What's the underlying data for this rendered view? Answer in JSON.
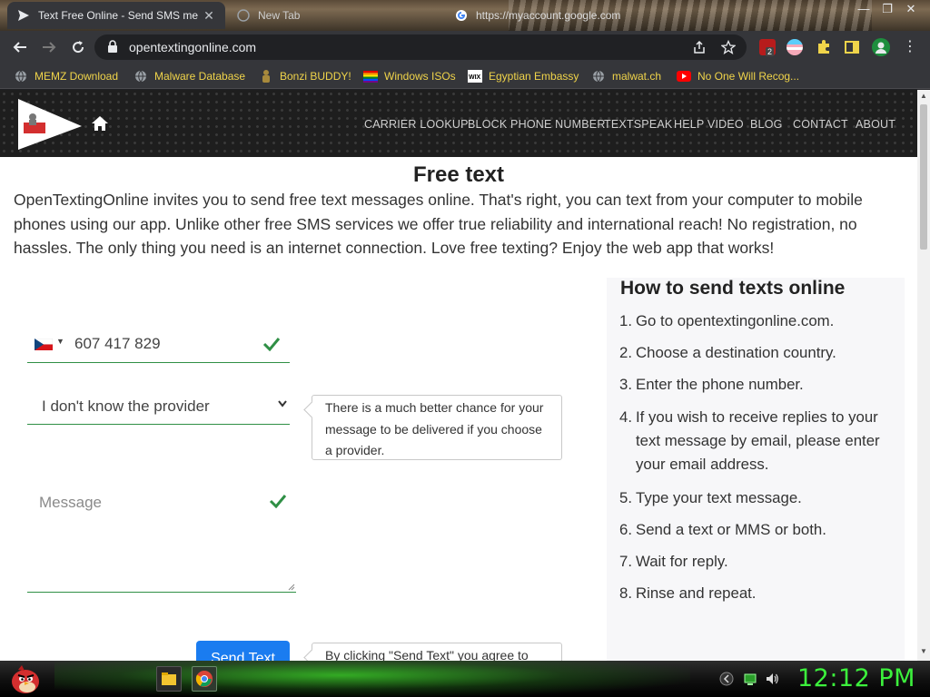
{
  "browser": {
    "tabs": [
      {
        "title": "Text Free Online - Send SMS me",
        "favicon": "send-arrow-icon",
        "active": true
      },
      {
        "title": "New Tab",
        "favicon": "globe-icon",
        "active": false
      },
      {
        "title": "https://myaccount.google.com",
        "favicon": "google-icon",
        "active": false
      }
    ],
    "url": "opentextingonline.com",
    "bookmarks": [
      {
        "label": "MEMZ Download",
        "icon": "globe-icon"
      },
      {
        "label": "Malware Database",
        "icon": "globe-icon"
      },
      {
        "label": "Bonzi BUDDY!",
        "icon": "bonzi-icon"
      },
      {
        "label": "Windows ISOs",
        "icon": "rainbow-flag-icon"
      },
      {
        "label": "Egyptian Embassy",
        "icon": "wix-icon"
      },
      {
        "label": "malwat.ch",
        "icon": "globe-icon"
      },
      {
        "label": "No One Will Recog...",
        "icon": "youtube-icon"
      }
    ],
    "extension_badge": "2"
  },
  "site": {
    "nav": [
      "CARRIER LOOKUP",
      "BLOCK PHONE NUMBER",
      "TEXTSPEAK",
      "HELP VIDEO",
      "BLOG",
      "CONTACT",
      "ABOUT"
    ],
    "title": "Free text",
    "intro": "OpenTextingOnline invites you to send free text messages online. That's right, you can text from your computer to mobile phones using our app. Unlike other free SMS services we offer true reliability and international reach! No registration, no hassles. The only thing you need is an internet connection. Love free texting? Enjoy the web app that works!",
    "form": {
      "country_flag": "czech-flag-icon",
      "phone_value": "607 417 829",
      "provider_value": "I don't know the provider",
      "provider_tip": "There is a much better chance for your message to be delivered if you choose a provider.",
      "message_placeholder": "Message",
      "send_label": "Send Text",
      "send_tip": "By clicking \"Send Text\" you agree to",
      "accent_color": "#2f8f45",
      "button_color": "#1a7cf0"
    },
    "howto": {
      "title": "How to send texts online",
      "steps": [
        {
          "n": "1.",
          "text": "Go to opentextingonline.com."
        },
        {
          "n": "2.",
          "text": "Choose a destination country."
        },
        {
          "n": "3.",
          "text": "Enter the phone number."
        },
        {
          "n": "4.",
          "text": "If you wish to receive replies to your text message by email, please enter your email address."
        },
        {
          "n": "5.",
          "text": "Type your text message."
        },
        {
          "n": "6.",
          "text": "Send a text or MMS or both."
        },
        {
          "n": "7.",
          "text": "Wait for reply."
        },
        {
          "n": "8.",
          "text": "Rinse and repeat."
        }
      ]
    }
  },
  "taskbar": {
    "clock": "12:12 PM",
    "clock_color": "#3cf03c"
  }
}
